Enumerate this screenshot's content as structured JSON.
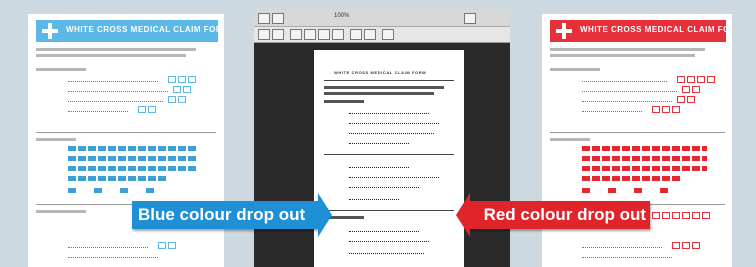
{
  "colors": {
    "blue": "#5bb8e8",
    "blue_fill": "#3d9fd6",
    "red": "#e8303a",
    "red_fill": "#e3262f",
    "callout_blue": "#1f8fd6",
    "callout_red": "#e0242c"
  },
  "left_doc": {
    "banner_title": "WHITE CROSS MEDICAL CLAIM FORM"
  },
  "right_doc": {
    "banner_title": "WHITE CROSS MEDICAL CLAIM FORM"
  },
  "center_window": {
    "zoom_label": "100%",
    "page_heading": "WHITE CROSS MEDICAL CLAIM FORM"
  },
  "callouts": {
    "blue": "Blue colour drop out",
    "red": "Red colour drop out"
  }
}
